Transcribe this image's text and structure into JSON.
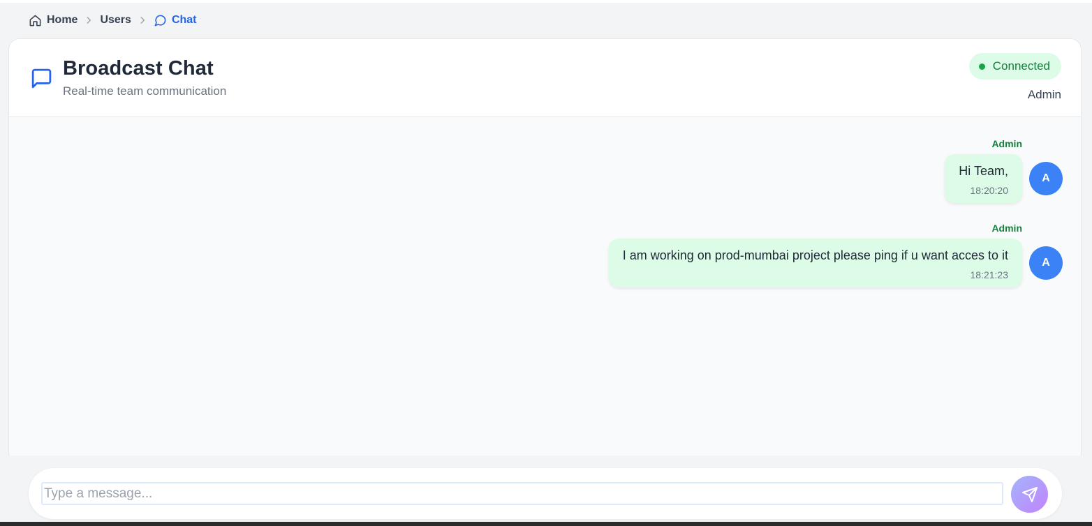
{
  "breadcrumb": {
    "items": [
      {
        "label": "Home",
        "icon": "home-icon"
      },
      {
        "label": "Users"
      },
      {
        "label": "Chat",
        "icon": "chat-bubble-icon"
      }
    ]
  },
  "header": {
    "title": "Broadcast Chat",
    "subtitle": "Real-time team communication",
    "icon": "message-square-icon",
    "status_label": "Connected",
    "status_color": "#16a34a",
    "user_label": "Admin"
  },
  "messages": [
    {
      "sender": "Admin",
      "text": "Hi Team,",
      "time": "18:20:20",
      "avatar": "A"
    },
    {
      "sender": "Admin",
      "text": "I am working on prod-mumbai project please ping if u want acces to it",
      "time": "18:21:23",
      "avatar": "A"
    }
  ],
  "composer": {
    "placeholder": "Type a message...",
    "value": "",
    "send_icon": "send-icon"
  },
  "colors": {
    "accent": "#2563eb",
    "bubble": "#dcfce7",
    "avatar": "#3b82f6",
    "sender": "#15803d"
  }
}
